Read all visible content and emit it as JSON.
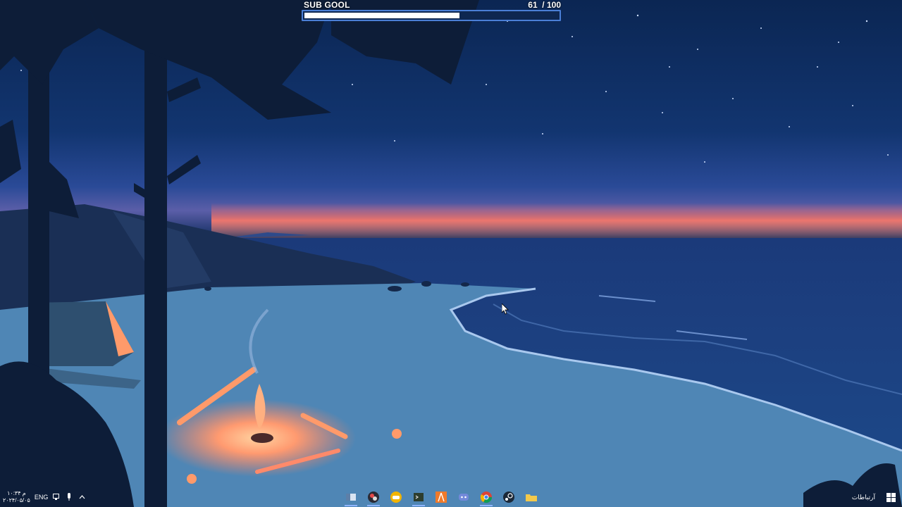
{
  "desktop": {
    "wallpaper": "night-beach-campfire-wallpaper"
  },
  "sub_goal": {
    "label": "SUB GOOL",
    "current": "61",
    "total": "/ 100",
    "progress": 0.61,
    "bar_color": "#4a7fd6"
  },
  "taskbar": {
    "clock_time": "۱۰:۳۴ م",
    "clock_date": "۲۰۲۴/۰۵/۰۵",
    "language": "ENG",
    "search_label": "آرتباطات",
    "pinned_apps": [
      {
        "name": "file-explorer-icon"
      },
      {
        "name": "obs-studio-icon"
      },
      {
        "name": "game-controller-icon"
      },
      {
        "name": "terminal-icon"
      },
      {
        "name": "adobe-acrobat-icon"
      },
      {
        "name": "discord-icon"
      },
      {
        "name": "chrome-icon"
      },
      {
        "name": "steam-icon"
      },
      {
        "name": "folder-icon"
      }
    ],
    "colors": {
      "accent": "#8fb4ff"
    }
  }
}
